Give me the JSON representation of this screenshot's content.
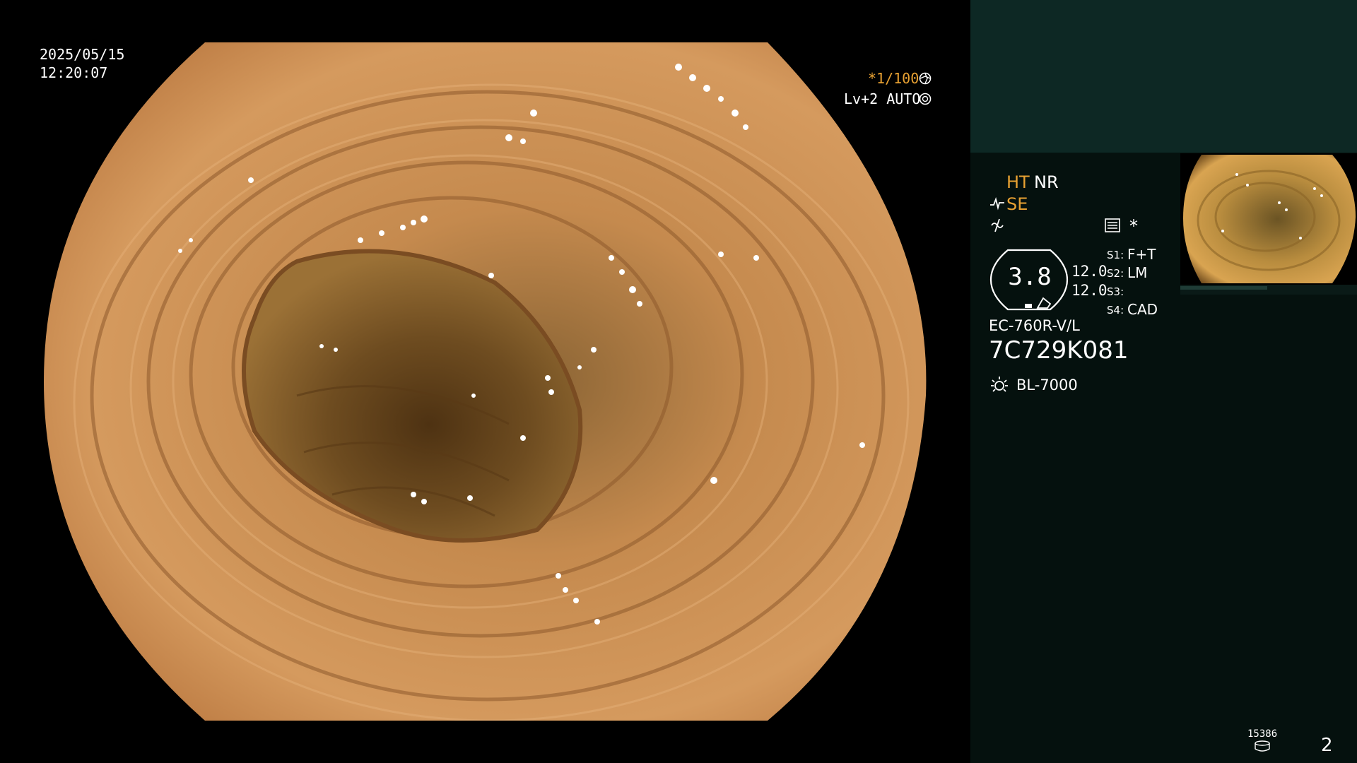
{
  "view": {
    "date": "2025/05/15",
    "time": "12:20:07",
    "shutter": "*1/100",
    "iris": "Lv+2 AUTO"
  },
  "panel": {
    "ht": "HT",
    "nr": "NR",
    "se": "SE",
    "gauge_value": "3.8",
    "val_a": "12.0",
    "val_b": "12.0",
    "asterisk": "*",
    "s1_label": "S1:",
    "s1_value": "F+T",
    "s2_label": "S2:",
    "s2_value": "LM",
    "s3_label": "S3:",
    "s3_value": "",
    "s4_label": "S4:",
    "s4_value": "CAD",
    "scope_model": "EC-760R-V/L",
    "serial": "7C729K081",
    "light_source": "BL-7000",
    "counter": "15386",
    "page_number": "2"
  },
  "colors": {
    "accent_orange": "#e8a132",
    "panel_bg": "#05110e",
    "panel_top_bg": "#0d2824",
    "mucosa": "#c88a4c"
  },
  "icons": [
    "shutter-icon",
    "iris-icon",
    "structure-icon",
    "color-icon",
    "menu-icon",
    "light-source-icon",
    "storage-icon"
  ]
}
